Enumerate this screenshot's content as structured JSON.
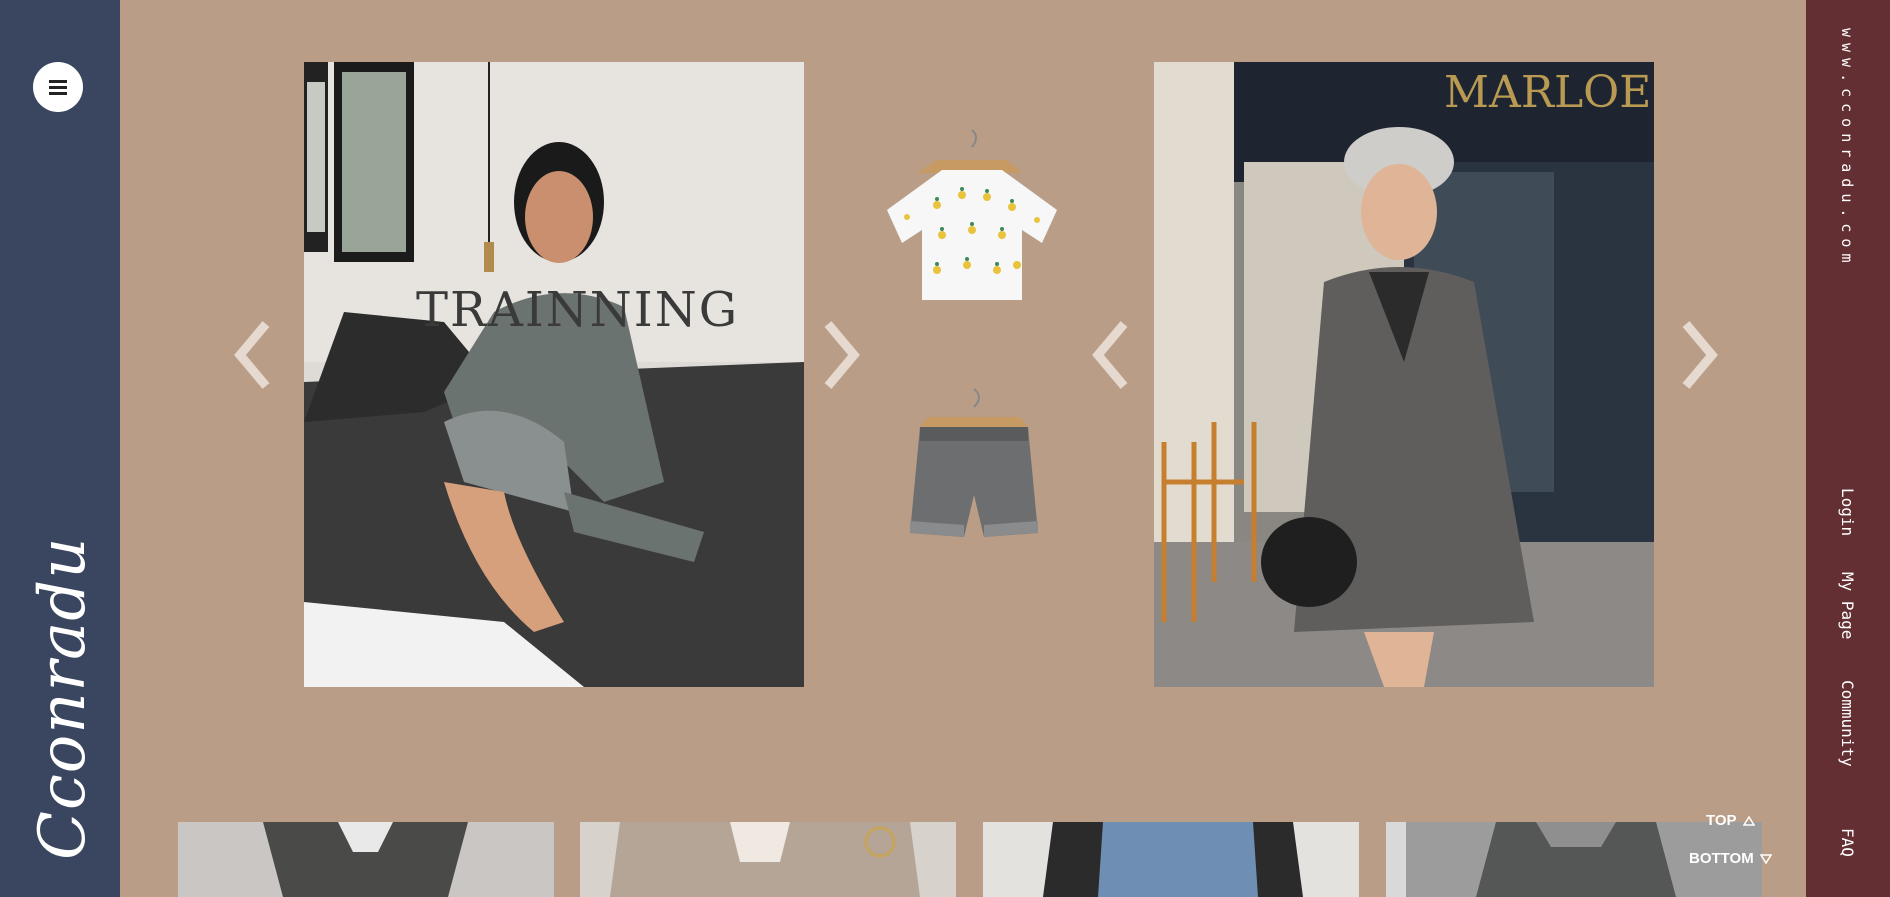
{
  "sidebar": {
    "menu_icon": "hamburger-icon",
    "brand": "Cconradu"
  },
  "right_nav": {
    "site_url": "www.cconradu.com",
    "items": [
      "Login",
      "My Page",
      "Community",
      "FAQ"
    ]
  },
  "slider": {
    "left_overlay_text": "TRAINNING",
    "storefront_sign": "MARLOE",
    "prev_icon": "chevron-left-icon",
    "next_icon": "chevron-right-icon"
  },
  "scroll": {
    "top_label": "TOP",
    "bottom_label": "BOTTOM"
  },
  "colors": {
    "background": "#b99d86",
    "left_sidebar": "#3a4660",
    "right_sidebar": "#632f33",
    "arrow": "#e6d9cf"
  }
}
